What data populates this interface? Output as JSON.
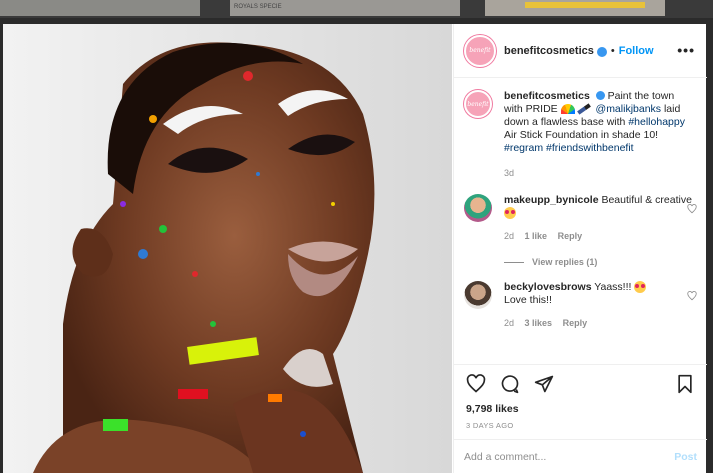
{
  "background_strip": {
    "caption": "ROYALS SPECIE"
  },
  "post": {
    "author": "benefitcosmetics",
    "avatar_text": "benefit",
    "separator": "•",
    "follow_label": "Follow",
    "more_label": "•••",
    "caption": {
      "text_1": "Paint the town with PRIDE ",
      "mention": "@malikjbanks",
      "text_2": " laid down a flawless base with ",
      "hashtag_1": "#hellohappy",
      "text_3": " Air Stick Foundation in shade 10! ",
      "hashtag_2": "#regram",
      "hashtag_3": "#friendswithbenefit",
      "age": "3d"
    },
    "comments": [
      {
        "user": "makeupp_bynicole",
        "text": "Beautiful & creative ",
        "age": "2d",
        "likes": "1 like",
        "reply": "Reply",
        "view_replies": "View replies (1)"
      },
      {
        "user": "beckylovesbrows",
        "text": "Yaass!!! ",
        "text_2": "Love this!!",
        "age": "2d",
        "likes": "3 likes",
        "reply": "Reply"
      }
    ],
    "likes_count": "9,798 likes",
    "date": "3 DAYS AGO",
    "add_comment_placeholder": "Add a comment...",
    "post_button": "Post"
  },
  "colors": {
    "accent": "#0095f6",
    "verified": "#3897f0",
    "brand_pink": "#f6a3b8"
  }
}
